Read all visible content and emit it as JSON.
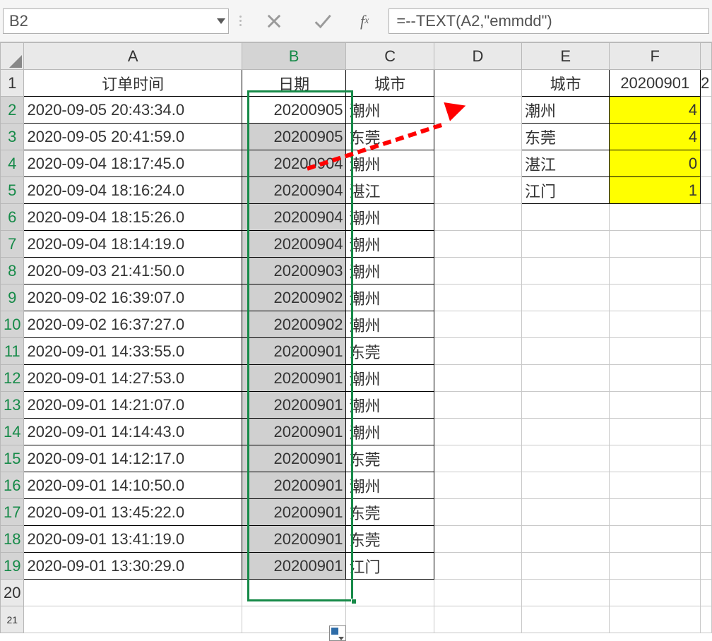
{
  "name_box": {
    "value": "B2"
  },
  "formula_bar": {
    "value": "=--TEXT(A2,\"emmdd\")"
  },
  "columns": [
    "A",
    "B",
    "C",
    "D",
    "E",
    "F"
  ],
  "headers": {
    "col_A": "订单时间",
    "col_B": "日期",
    "col_C": "城市",
    "col_E": "城市",
    "col_F": "20200901"
  },
  "rows": [
    {
      "num": "1"
    },
    {
      "num": "2",
      "a": "2020-09-05 20:43:34.0",
      "b": "20200905",
      "c": "潮州",
      "e": "潮州",
      "f": "4"
    },
    {
      "num": "3",
      "a": "2020-09-05 20:41:59.0",
      "b": "20200905",
      "c": "东莞",
      "e": "东莞",
      "f": "4"
    },
    {
      "num": "4",
      "a": "2020-09-04 18:17:45.0",
      "b": "20200904",
      "c": "潮州",
      "e": "湛江",
      "f": "0"
    },
    {
      "num": "5",
      "a": "2020-09-04 18:16:24.0",
      "b": "20200904",
      "c": "湛江",
      "e": "江门",
      "f": "1"
    },
    {
      "num": "6",
      "a": "2020-09-04 18:15:26.0",
      "b": "20200904",
      "c": "潮州"
    },
    {
      "num": "7",
      "a": "2020-09-04 18:14:19.0",
      "b": "20200904",
      "c": "潮州"
    },
    {
      "num": "8",
      "a": "2020-09-03 21:41:50.0",
      "b": "20200903",
      "c": "潮州"
    },
    {
      "num": "9",
      "a": "2020-09-02 16:39:07.0",
      "b": "20200902",
      "c": "潮州"
    },
    {
      "num": "10",
      "a": "2020-09-02 16:37:27.0",
      "b": "20200902",
      "c": "潮州"
    },
    {
      "num": "11",
      "a": "2020-09-01 14:33:55.0",
      "b": "20200901",
      "c": "东莞"
    },
    {
      "num": "12",
      "a": "2020-09-01 14:27:53.0",
      "b": "20200901",
      "c": "潮州"
    },
    {
      "num": "13",
      "a": "2020-09-01 14:21:07.0",
      "b": "20200901",
      "c": "潮州"
    },
    {
      "num": "14",
      "a": "2020-09-01 14:14:43.0",
      "b": "20200901",
      "c": "潮州"
    },
    {
      "num": "15",
      "a": "2020-09-01 14:12:17.0",
      "b": "20200901",
      "c": "东莞"
    },
    {
      "num": "16",
      "a": "2020-09-01 14:10:50.0",
      "b": "20200901",
      "c": "潮州"
    },
    {
      "num": "17",
      "a": "2020-09-01 13:45:22.0",
      "b": "20200901",
      "c": "东莞"
    },
    {
      "num": "18",
      "a": "2020-09-01 13:41:19.0",
      "b": "20200901",
      "c": "东莞"
    },
    {
      "num": "19",
      "a": "2020-09-01 13:30:29.0",
      "b": "20200901",
      "c": "江门"
    },
    {
      "num": "20"
    },
    {
      "num": "21"
    }
  ],
  "partial_col_G_header": "2"
}
